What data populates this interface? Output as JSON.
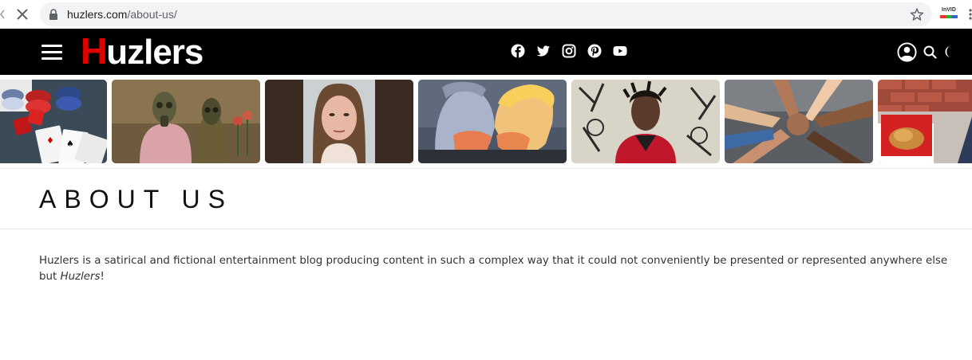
{
  "browser": {
    "url_host": "huzlers.com",
    "url_path": "/about-us/",
    "extension_label": "InVID"
  },
  "header": {
    "logo_first": "H",
    "logo_rest": "uzlers",
    "social_icons": [
      "facebook-icon",
      "twitter-icon",
      "instagram-icon",
      "pinterest-icon",
      "youtube-icon"
    ],
    "right_icons": [
      "user-icon",
      "search-icon",
      "moon-icon"
    ],
    "accent_color": "#e00000",
    "background_color": "#000000"
  },
  "thumbnails": [
    {
      "subject": "casino chips, dice and playing cards"
    },
    {
      "subject": "two figures in gas masks"
    },
    {
      "subject": "woman mugshot"
    },
    {
      "subject": "mural of two leaders kissing"
    },
    {
      "subject": "man in red jacket with patterned background"
    },
    {
      "subject": "hands stacked in a circle"
    },
    {
      "subject": "fried chicken box near brick wall"
    }
  ],
  "page": {
    "title": "ABOUT US",
    "body_start": "Huzlers is a satirical and fictional entertainment blog producing content in such a complex way that it could not conveniently be presented or represented anywhere else but ",
    "body_em": "Huzlers",
    "body_end": "!"
  }
}
